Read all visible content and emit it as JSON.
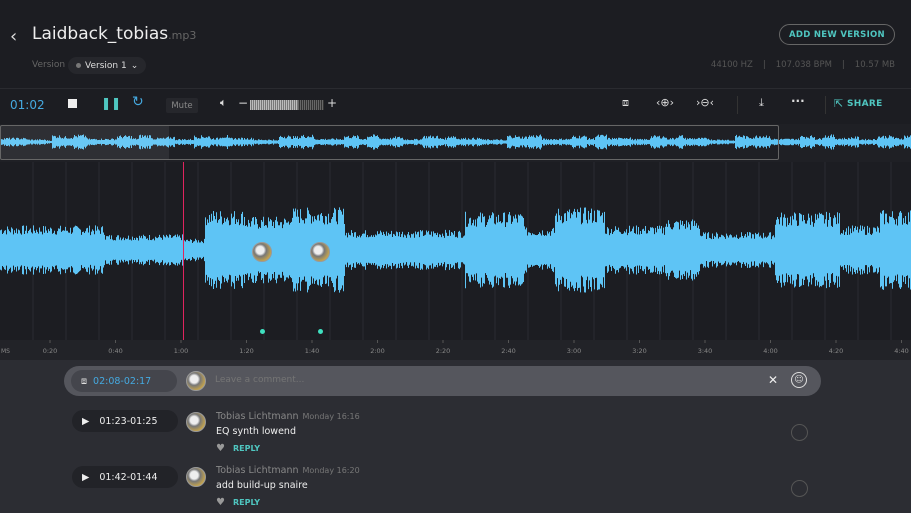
{
  "header": {
    "title": "Laidback_tobias",
    "ext": ".mp3",
    "version_label": "Version",
    "version_value": "Version 1",
    "add_version": "ADD NEW VERSION",
    "sample_rate": "44100 HZ",
    "bpm": "107.038 BPM",
    "size": "10.57 MB"
  },
  "toolbar": {
    "time": "01:02",
    "mute": "Mute",
    "share": "SHARE",
    "volume": 0.65
  },
  "colors": {
    "accent": "#45a9e0",
    "teal": "#4fc6c0",
    "wave": "#5ec4f5",
    "playhead": "#e0245e"
  },
  "timeline": {
    "unit": "MS",
    "ticks": [
      "0:20",
      "0:40",
      "1:00",
      "1:20",
      "1:40",
      "2:00",
      "2:20",
      "2:40",
      "3:00",
      "3:20",
      "3:40",
      "4:00",
      "4:20",
      "4:40"
    ]
  },
  "comment_bar": {
    "range": "02:08-02:17",
    "placeholder": "Leave a comment..."
  },
  "comments": [
    {
      "range": "01:23-01:25",
      "author": "Tobias Lichtmann",
      "time": "Monday 16:16",
      "text": "EQ synth lowend",
      "reply": "REPLY"
    },
    {
      "range": "01:42-01:44",
      "author": "Tobias Lichtmann",
      "time": "Monday 16:20",
      "text": "add build-up snaire",
      "reply": "REPLY"
    }
  ]
}
